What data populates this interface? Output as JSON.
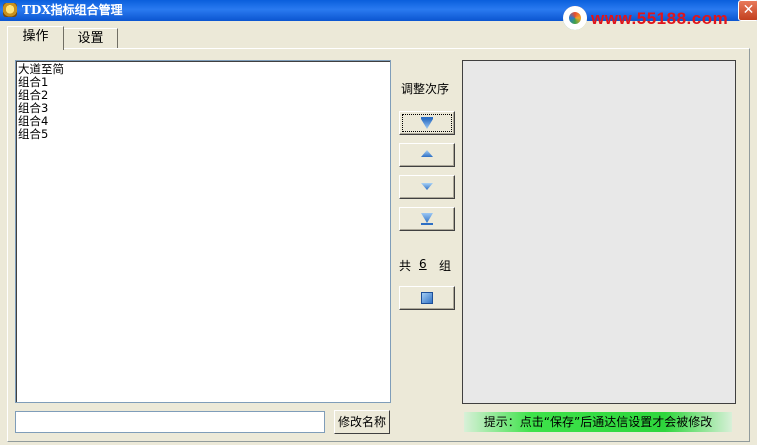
{
  "window": {
    "title": "TDX指标组合管理",
    "close_glyph": "✕"
  },
  "watermark": {
    "text": "www.55188.com"
  },
  "tabs": [
    {
      "label": "操作",
      "active": true
    },
    {
      "label": "设置",
      "active": false
    }
  ],
  "combo_list": {
    "items": [
      "大道至简",
      "组合1",
      "组合2",
      "组合3",
      "组合4",
      "组合5"
    ]
  },
  "order": {
    "label": "调整次序",
    "buttons": [
      "move-top",
      "move-up",
      "move-down",
      "move-bottom"
    ]
  },
  "count": {
    "prefix": "共",
    "value": "6",
    "suffix": "组"
  },
  "rename": {
    "input_value": "",
    "button_label": "修改名称"
  },
  "hint": {
    "text": "提示：点击“保存”后通达信设置才会被修改"
  },
  "colors": {
    "titlebar": "#0a5fdc",
    "hint_green": "#2ed63c",
    "face": "#ece9d8"
  }
}
